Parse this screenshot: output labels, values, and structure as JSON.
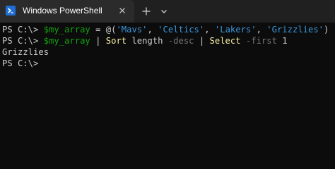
{
  "window": {
    "tab_title": "Windows PowerShell",
    "icons": {
      "tab_icon": "powershell-icon",
      "close": "close-icon",
      "new_tab": "plus-icon",
      "dropdown": "chevron-down-icon"
    },
    "colors": {
      "titlebar": "#202020",
      "active_tab": "#2b2b2b",
      "terminal_bg": "#0c0c0c"
    }
  },
  "terminal": {
    "line1": {
      "prompt": "PS C:\\> ",
      "var": "$my_array",
      "op": " = ",
      "open": "@(",
      "s1": "'Mavs'",
      "sep1": ", ",
      "s2": "'Celtics'",
      "sep2": ", ",
      "s3": "'Lakers'",
      "sep3": ", ",
      "s4": "'Grizzlies'",
      "close": ")"
    },
    "line2": {
      "prompt": "PS C:\\> ",
      "var": "$my_array",
      "pipe1": " | ",
      "cmd1": "Sort",
      "arg1": " length",
      "param1": " -desc",
      "pipe2": " | ",
      "cmd2": "Select",
      "param2": " -first",
      "num": " 1"
    },
    "line3": {
      "output": "Grizzlies"
    },
    "line4": {
      "prompt": "PS C:\\> "
    },
    "colors": {
      "variable": "#13a10e",
      "string": "#3a96dd",
      "command": "#f9f1a5",
      "parameter": "#767676",
      "text": "#cccccc"
    }
  }
}
